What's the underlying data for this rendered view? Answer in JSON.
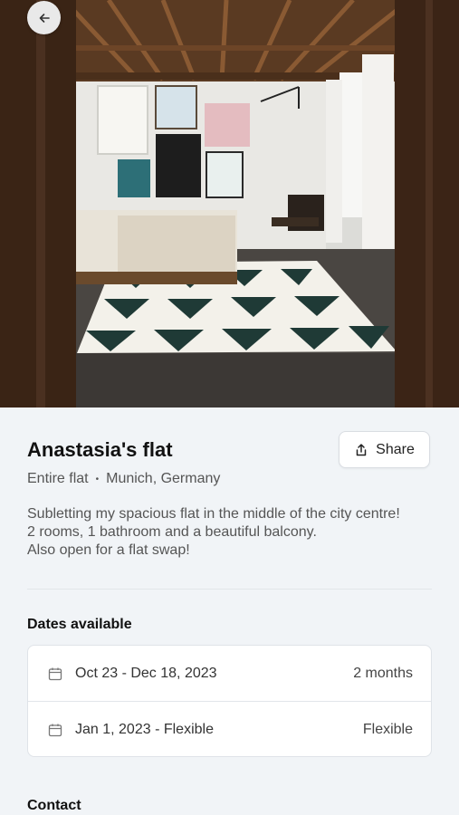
{
  "nav": {
    "back_icon": "arrow-left-icon"
  },
  "listing": {
    "title": "Anastasia's flat",
    "type": "Entire flat",
    "separator": "•",
    "location": "Munich, Germany",
    "description": [
      "Subletting my spacious flat in the middle of the city centre!",
      "2 rooms, 1 bathroom and a beautiful balcony.",
      "Also open for a flat swap!"
    ]
  },
  "share": {
    "label": "Share",
    "icon": "share-icon"
  },
  "dates": {
    "title": "Dates available",
    "rows": [
      {
        "range": "Oct 23 - Dec 18, 2023",
        "duration": "2 months",
        "icon": "calendar-icon"
      },
      {
        "range": "Jan 1, 2023 - Flexible",
        "duration": "Flexible",
        "icon": "calendar-icon"
      }
    ]
  },
  "contact": {
    "title": "Contact"
  },
  "colors": {
    "background": "#f1f4f7",
    "card": "#ffffff",
    "text": "#111111",
    "muted": "#555555"
  }
}
